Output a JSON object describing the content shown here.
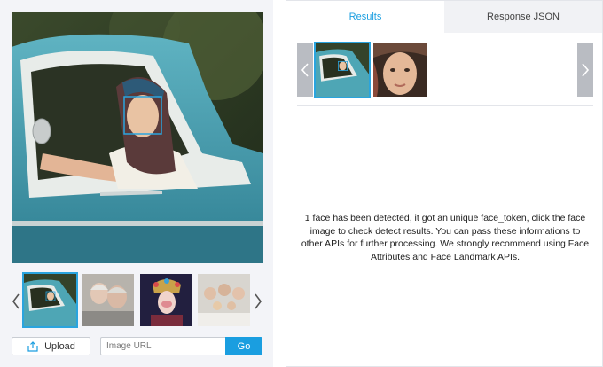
{
  "left_panel": {
    "main_image": {
      "subject": "woman in patterned headscarf leaning out of vintage teal pickup truck",
      "face_box_color": "#2aa4de"
    },
    "thumbnails": [
      {
        "subject": "woman in teal truck",
        "active": true
      },
      {
        "subject": "elderly couple smiling",
        "active": false
      },
      {
        "subject": "opera performer in ornate headdress",
        "active": false
      },
      {
        "subject": "family group portrait",
        "active": false
      }
    ],
    "icons": {
      "prev": "chevron-left-icon",
      "next": "chevron-right-icon",
      "upload": "upload-icon"
    },
    "upload_label": "Upload",
    "url_placeholder": "Image URL",
    "url_value": "",
    "go_label": "Go"
  },
  "right_panel": {
    "tabs": [
      {
        "label": "Results",
        "active": true
      },
      {
        "label": "Response JSON",
        "active": false
      }
    ],
    "face_results": [
      {
        "subject": "detected image thumbnail",
        "active": true
      },
      {
        "subject": "cropped detected face",
        "active": false
      }
    ],
    "message": "1 face has been detected, it got an unique face_token, click the face image to check detect results. You can pass these informations to other APIs for further processing. We strongly recommend using Face Attributes and Face Landmark APIs."
  },
  "colors": {
    "accent": "#1a9ee0",
    "face_box": "#2aa4de",
    "panel_bg": "#f3f4f8",
    "inactive_tab": "#f1f2f5"
  }
}
